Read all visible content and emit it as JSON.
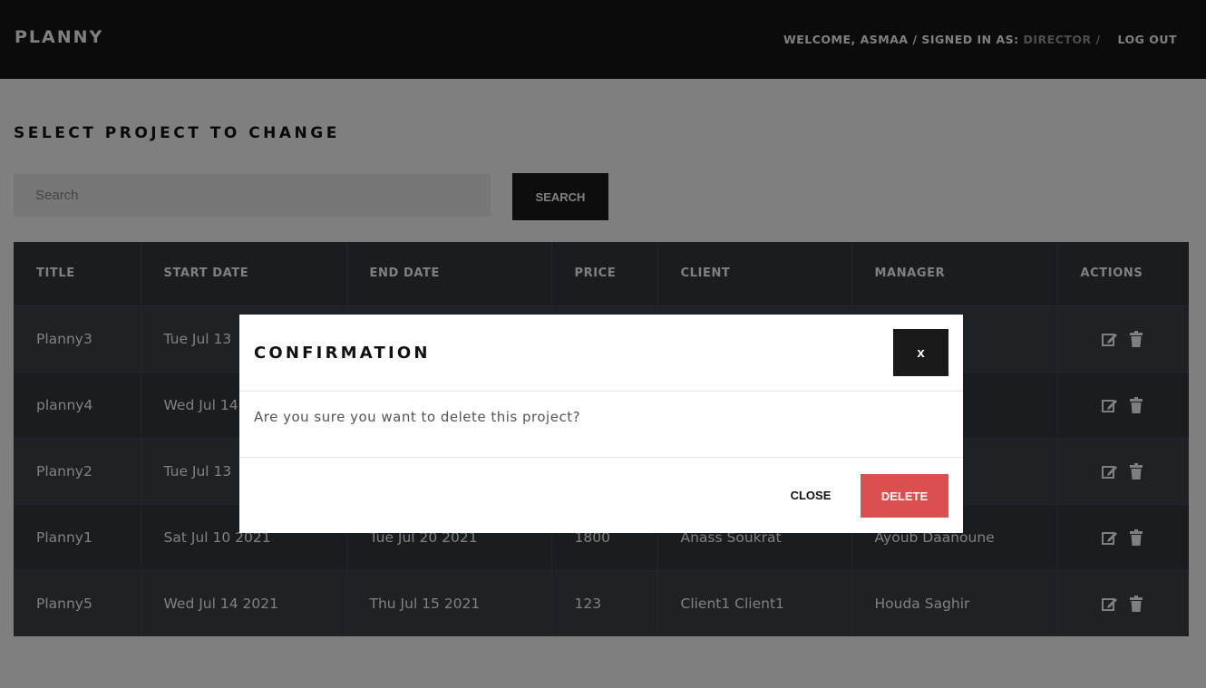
{
  "navbar": {
    "brand": "PLANNY",
    "welcome": "WELCOME, ASMAA /",
    "signed_in_label": "SIGNED IN AS:",
    "role": "DIRECTOR /",
    "logout": "LOG OUT"
  },
  "page": {
    "title": "SELECT PROJECT TO CHANGE",
    "search_placeholder": "Search",
    "search_button": "SEARCH"
  },
  "table": {
    "headers": [
      "TITLE",
      "START DATE",
      "END DATE",
      "PRICE",
      "CLIENT",
      "MANAGER",
      "ACTIONS"
    ],
    "rows": [
      [
        "Planny3",
        "Tue Jul 13",
        "",
        "",
        "",
        "r"
      ],
      [
        "planny4",
        "Wed Jul 14",
        "",
        "",
        "",
        "oune"
      ],
      [
        "Planny2",
        "Tue Jul 13",
        "",
        "",
        "",
        "oune"
      ],
      [
        "Planny1",
        "Sat Jul 10 2021",
        "Tue Jul 20 2021",
        "1800",
        "Anass Soukrat",
        "Ayoub Daanoune"
      ],
      [
        "Planny5",
        "Wed Jul 14 2021",
        "Thu Jul 15 2021",
        "123",
        "Client1 Client1",
        "Houda Saghir"
      ]
    ],
    "action_icons": [
      "edit-icon",
      "trash-icon"
    ]
  },
  "modal": {
    "title": "CONFIRMATION",
    "close_x": "x",
    "message": "Are you sure you want to delete this project?",
    "close_button": "CLOSE",
    "delete_button": "DELETE"
  },
  "colors": {
    "navbar_bg": "#171717",
    "table_header_bg": "#343a40",
    "row_odd_bg": "#3e444a",
    "row_even_bg": "#343a40",
    "delete_accent": "#dc4f4f",
    "overlay": "rgba(0,0,0,0.5)"
  }
}
